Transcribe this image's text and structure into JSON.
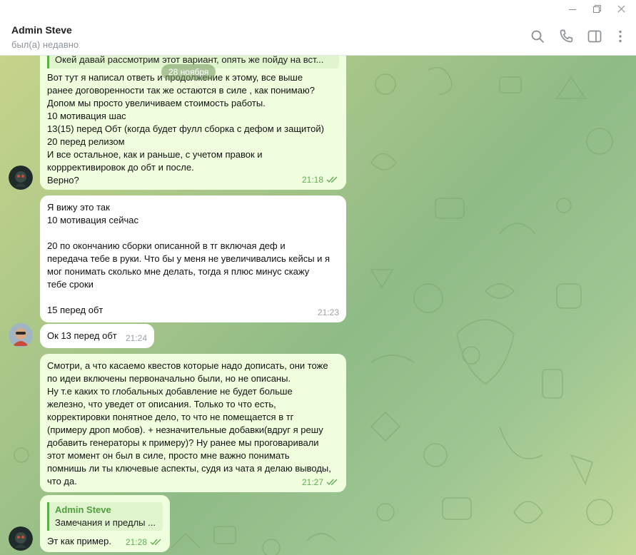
{
  "window": {
    "controls": [
      "minimize-icon",
      "maximize-icon",
      "close-icon"
    ]
  },
  "header": {
    "name": "Admin Steve",
    "status": "был(а) недавно",
    "icons": [
      "search-icon",
      "phone-icon",
      "sidebar-toggle-icon",
      "more-vertical-icon"
    ]
  },
  "chat": {
    "date_pill": "28 ноября",
    "messages": [
      {
        "direction": "out",
        "reply_preview": "Окей давай рассмотрим этот вариант, опять же пойду на вст...",
        "text": "Вот тут я написал ответь  и продолжение к этому, все выше\nранее договоренности так же остаются в силе , как понимаю?\nДопом мы просто увеличиваем стоимость работы.\n10 мотивация шас\n13(15) перед Обт (когда будет фулл сборка с дефом и защитой)\n20 перед релизом\nИ все остальное, как и раньше, с учетом правок и\nкорррективировок до обт и после.\nВерно?",
        "time": "21:18",
        "read": true
      },
      {
        "direction": "in",
        "text": "Я вижу это так\n10 мотивация сейчас\n\n20 по окончанию сборки описанной в тг включая деф и\nпередача тебе в руки. Что бы у меня не увеличивались кейсы и я\nмог понимать сколько мне делать, тогда я плюс минус скажу\nтебе сроки\n\n15 перед обт",
        "time": "21:23"
      },
      {
        "direction": "in",
        "text": "Ок 13 перед обт",
        "time": "21:24"
      },
      {
        "direction": "out",
        "text": "Смотри, а что касаемо квестов которые надо дописать, они тоже\nпо идеи включены первоначально были, но не описаны.\nНу т.е каких то глобальных добавление не будет больше\nжелезно, что уведет от описания. Только то что есть,\nкорректировки понятное дело, то что не помещается в тг\n(примеру дроп мобов). + незначительные добавки(вдруг я решу\nдобавить генераторы к примеру)? Ну ранее мы проговаривали\nэтот момент он был в силе, просто мне важно понимать\nпомнишь ли ты ключевые аспекты, судя из чата я делаю выводы,\nчто да.",
        "time": "21:27",
        "read": true
      },
      {
        "direction": "out",
        "reply_author": "Admin Steve",
        "reply_preview": "Замечания и предлы ...",
        "text": "Эт как пример.",
        "time": "21:28",
        "read": true
      }
    ]
  },
  "colors": {
    "bubble_out": "#effedd",
    "bubble_in": "#ffffff",
    "accent_green": "#62ac55",
    "quote_bar": "#5fae4e"
  }
}
